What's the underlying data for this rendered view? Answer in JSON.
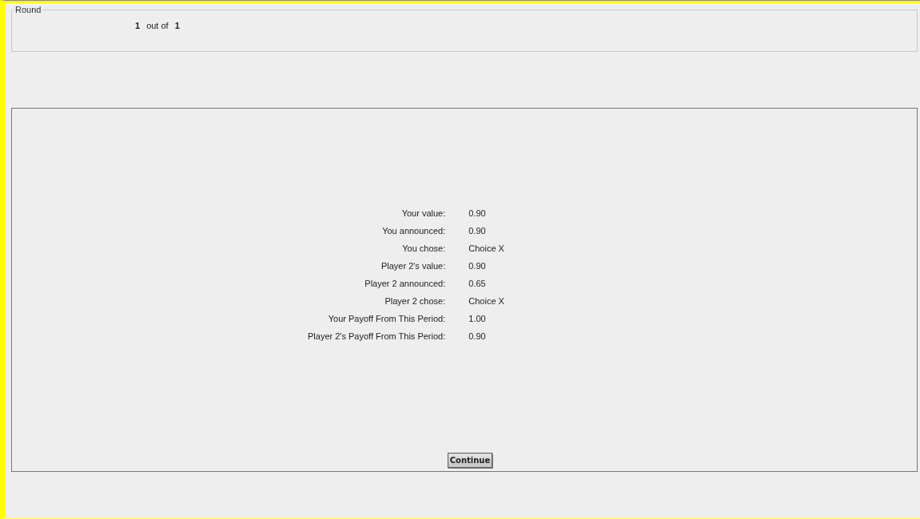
{
  "round": {
    "legend": "Round",
    "current": "1",
    "separator": "out of",
    "total": "1"
  },
  "results": [
    {
      "label": "Your value:",
      "value": "0.90"
    },
    {
      "label": "You announced:",
      "value": "0.90"
    },
    {
      "label": "You chose:",
      "value": "Choice X"
    },
    {
      "label": "Player 2's value:",
      "value": "0.90"
    },
    {
      "label": "Player 2 announced:",
      "value": "0.65"
    },
    {
      "label": "Player 2 chose:",
      "value": "Choice X"
    },
    {
      "label": "Your Payoff From This Period:",
      "value": "1.00"
    },
    {
      "label": "Player 2's Payoff From This Period:",
      "value": "0.90"
    }
  ],
  "continue_button": "Continue"
}
